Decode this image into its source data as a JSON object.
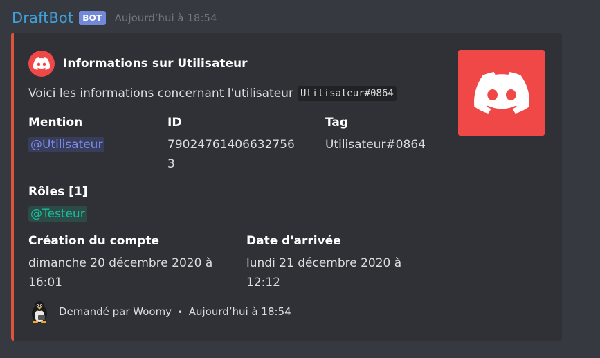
{
  "message": {
    "username": "DraftBot",
    "bot_tag": "BOT",
    "timestamp": "Aujourd’hui à 18:54"
  },
  "embed": {
    "accent_color": "#e0533b",
    "author_name": "Informations sur Utilisateur",
    "description_text": "Voici les informations concernant l'utilisateur",
    "description_code": "Utilisateur#0864",
    "fields": {
      "mention": {
        "name": "Mention",
        "value": "@Utilisateur"
      },
      "id": {
        "name": "ID",
        "value_line1": "79024761406632756",
        "value_line2": "3"
      },
      "tag": {
        "name": "Tag",
        "value": "Utilisateur#0864"
      },
      "roles": {
        "name": "Rôles [1]",
        "value": "@Testeur"
      },
      "creation": {
        "name": "Création du compte",
        "value_line1": "dimanche 20 décembre 2020 à",
        "value_line2": "16:01"
      },
      "arrival": {
        "name": "Date d'arrivée",
        "value_line1": "lundi 21 décembre 2020 à",
        "value_line2": "12:12"
      }
    },
    "thumbnail_icon": "discord-logo-icon",
    "footer": {
      "icon": "penguin-avatar-icon",
      "requested_by": "Demandé par Woomy",
      "separator": "•",
      "timestamp": "Aujourd’hui à 18:54"
    }
  },
  "colors": {
    "background": "#36393f",
    "embed_background": "#2f3136",
    "username": "#3f9fdb",
    "bot_tag": "#7289da",
    "discord_red": "#f04747",
    "mention": "#7b8ce6",
    "role_mention": "#1abc9c"
  }
}
